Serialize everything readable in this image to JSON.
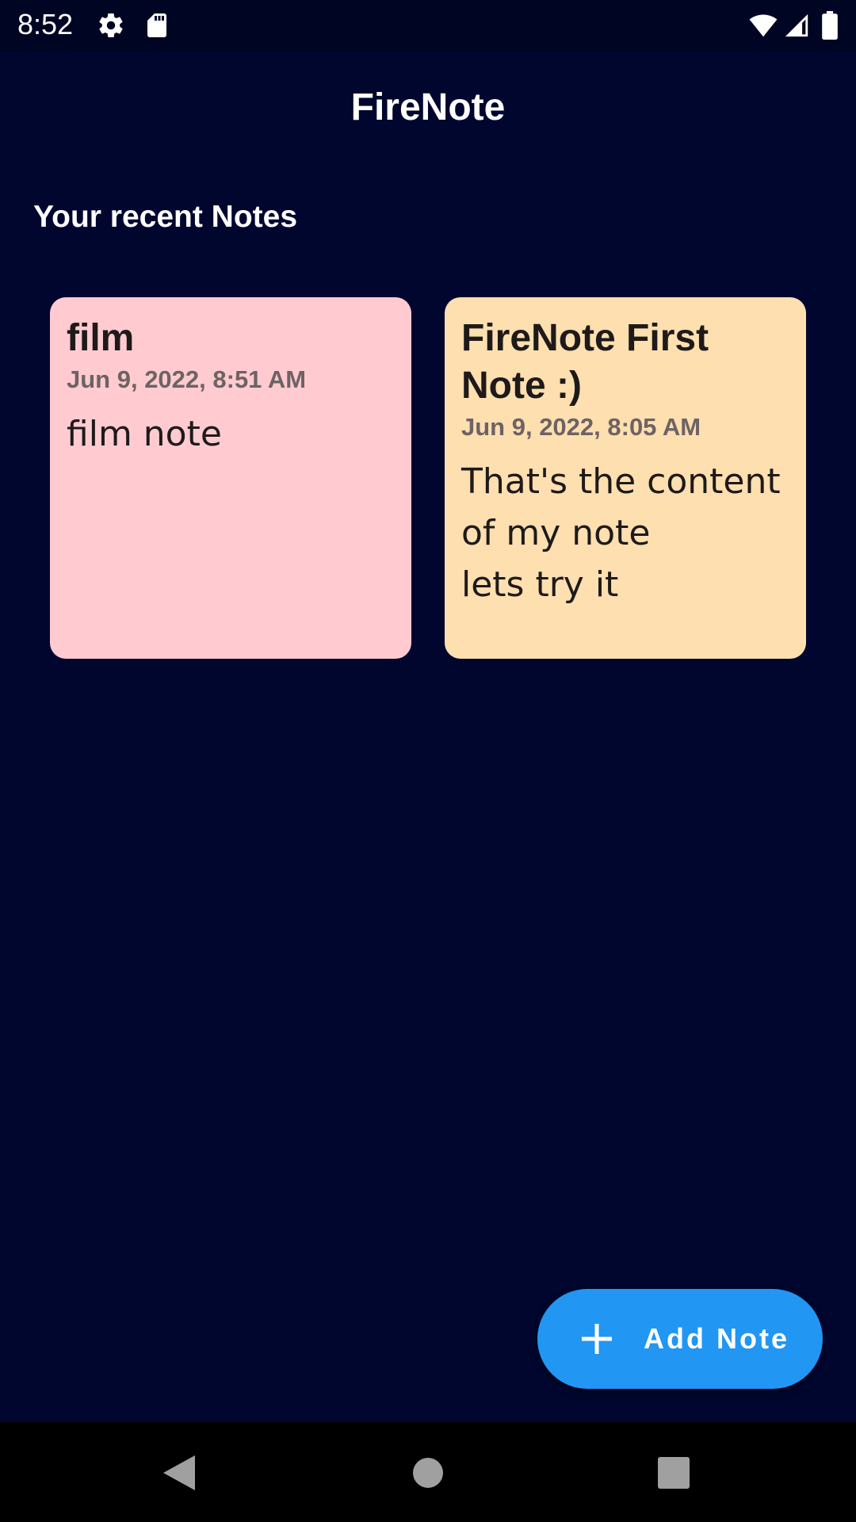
{
  "status_bar": {
    "time": "8:52",
    "icons": [
      "settings-icon",
      "sd-card-icon",
      "wifi-icon",
      "signal-icon",
      "battery-icon"
    ]
  },
  "header": {
    "title": "FireNote"
  },
  "section": {
    "title": "Your recent Notes"
  },
  "notes": [
    {
      "title": "film",
      "date": "Jun 9, 2022, 8:51 AM",
      "content": "film note",
      "color": "#ffcbd1"
    },
    {
      "title": "FireNote First Note :)",
      "date": "Jun 9, 2022, 8:05 AM",
      "content": "That's the content of my note\nlets try it",
      "color": "#fedfb0"
    }
  ],
  "fab": {
    "label": "Add Note",
    "icon": "plus-icon",
    "color": "#2196f3"
  },
  "nav_bar": {
    "icons": [
      "back-icon",
      "home-icon",
      "recents-icon"
    ]
  },
  "colors": {
    "background": "#01062f",
    "status_bar": "#000523",
    "text_primary": "#ffffff"
  }
}
